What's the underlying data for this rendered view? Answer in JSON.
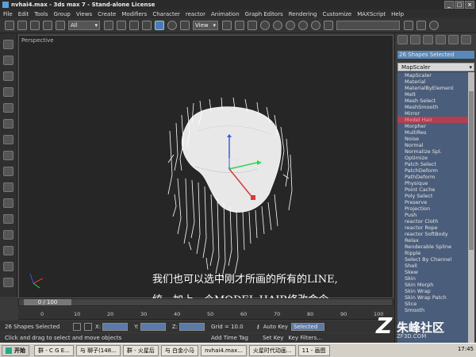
{
  "window": {
    "title": "nvhai4.max - 3ds max 7 - Stand-alone License",
    "buttons": [
      "_",
      "□",
      "×"
    ]
  },
  "menu": [
    "File",
    "Edit",
    "Tools",
    "Group",
    "Views",
    "Create",
    "Modifiers",
    "Character",
    "reactor",
    "Animation",
    "Graph Editors",
    "Rendering",
    "Customize",
    "MAXScript",
    "Help"
  ],
  "toolbar": {
    "selection_filter": "All",
    "reference_coord": "View"
  },
  "viewport": {
    "label": "Perspective",
    "subtitle_line1": "我们也可以选中刚才所画的所有的LINE,",
    "subtitle_line2": "统一加上一个MODEL HAIR修改命令"
  },
  "command_panel": {
    "status": "26 Shapes Selected",
    "modifier_dropdown": "MapScaler",
    "modifiers": [
      "MapScaler",
      "Material",
      "MaterialByElement",
      "Melt",
      "Mesh Select",
      "MeshSmooth",
      "Mirror",
      "Model Hair",
      "Morpher",
      "MultiRes",
      "Noise",
      "Normal",
      "Normalize Spl.",
      "Optimize",
      "Patch Select",
      "PatchDeform",
      "PathDeform",
      "Physique",
      "Point Cache",
      "Poly Select",
      "Preserve",
      "Projection",
      "Push",
      "reactor Cloth",
      "reactor Rope",
      "reactor SoftBody",
      "Relax",
      "Renderable Spline",
      "Ripple",
      "Select By Channel",
      "Shell",
      "Skew",
      "Skin",
      "Skin Morph",
      "Skin Wrap",
      "Skin Wrap Patch",
      "Slice",
      "Smooth"
    ],
    "highlighted": "Model Hair"
  },
  "timeline": {
    "frame": "0 / 100",
    "ticks": [
      "0",
      "10",
      "20",
      "30",
      "40",
      "50",
      "60",
      "70",
      "80",
      "90",
      "100"
    ]
  },
  "status": {
    "selection": "26 Shapes Selected",
    "prompt": "Click and drag to select and move objects",
    "x_label": "X:",
    "y_label": "Y:",
    "z_label": "Z:",
    "grid": "Grid = 10.0",
    "add_time_tag": "Add Time Tag",
    "auto_key": "Auto Key",
    "selected": "Selected",
    "set_key": "Set Key",
    "key_filters": "Key Filters..."
  },
  "taskbar": {
    "start": "开始",
    "tasks": [
      "群 - C G E...",
      "与 聊子(148...",
      "群 - 火星后",
      "与 白金小马",
      "nvhai4.max...",
      "火星时代动画...",
      "11 - 画图"
    ],
    "clock": "17:45"
  },
  "watermark": {
    "text": "朱峰社区",
    "url": "ZF3D.COM"
  },
  "colors": {
    "highlight": "#b04050",
    "list_bg": "#4a5d7a",
    "status_blue": "#5a88b8"
  }
}
